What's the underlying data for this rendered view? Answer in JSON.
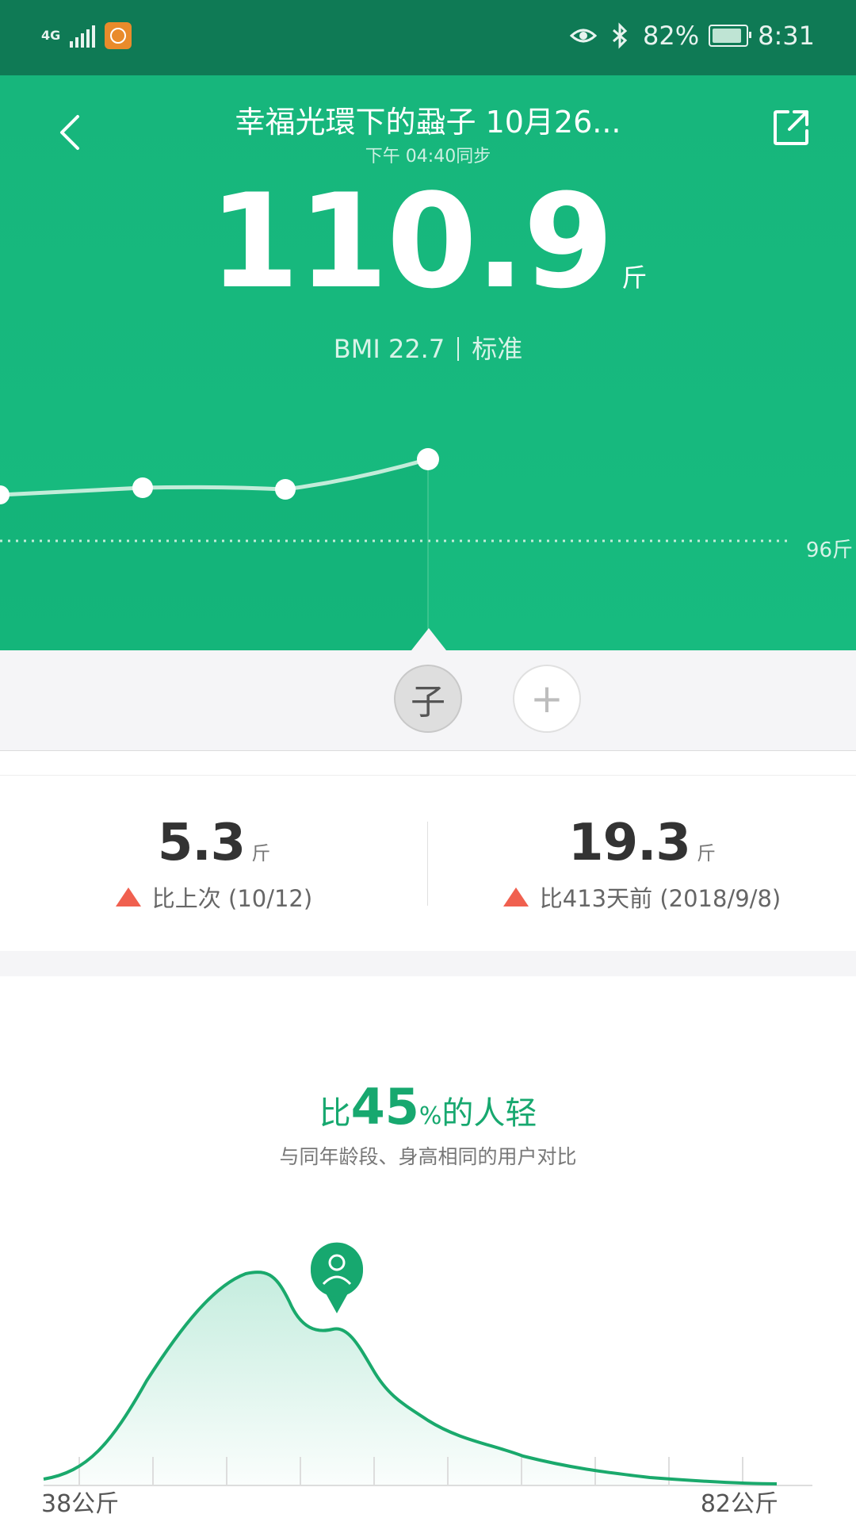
{
  "status_bar": {
    "network": "4G",
    "battery": "82%",
    "time": "8:31"
  },
  "header": {
    "title": "幸福光環下的蝨子 10月26...",
    "sync_time": "下午 04:40同步",
    "weight": "110.9",
    "weight_unit": "斤",
    "bmi": "BMI 22.7",
    "bmi_status": "标准",
    "reference_label": "96斤"
  },
  "profiles": {
    "current_initial": "子",
    "add_symbol": "+"
  },
  "comparison": {
    "last": {
      "value": "5.3",
      "unit": "斤",
      "note": "比上次 (10/12)",
      "direction": "up"
    },
    "since": {
      "value": "19.3",
      "unit": "斤",
      "note": "比413天前 (2018/9/8)",
      "direction": "up"
    }
  },
  "distribution": {
    "prefix": "比",
    "percent": "45",
    "suffix": "的人轻",
    "subtitle": "与同年龄段、身高相同的用户对比",
    "min_label": "38公斤",
    "max_label": "82公斤"
  },
  "colors": {
    "brand": "#17b67c",
    "statusbar": "#0f7a55",
    "up_arrow": "#f0604f",
    "curve": "#1aa96c"
  },
  "icons": [
    "back-arrow-icon",
    "share-icon",
    "eye-icon",
    "bluetooth-icon",
    "battery-icon",
    "user-pin-icon"
  ]
}
